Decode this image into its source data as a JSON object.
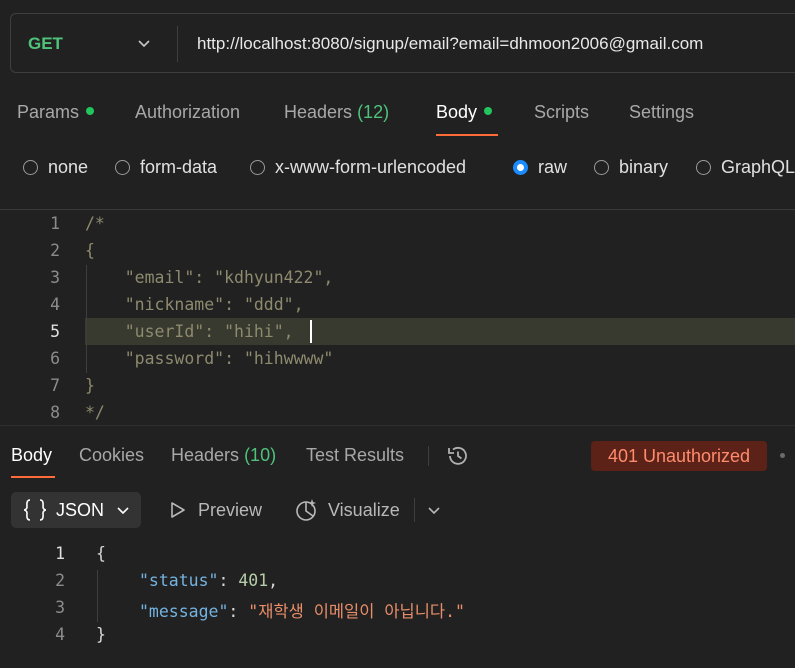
{
  "request": {
    "method": "GET",
    "url": "http://localhost:8080/signup/email?email=dhmoon2006@gmail.com"
  },
  "request_tabs": [
    {
      "label": "Params"
    },
    {
      "label": "Authorization"
    },
    {
      "label": "Headers",
      "count": "(12)"
    },
    {
      "label": "Body"
    },
    {
      "label": "Scripts"
    },
    {
      "label": "Settings"
    }
  ],
  "body_types": [
    "none",
    "form-data",
    "x-www-form-urlencoded",
    "raw",
    "binary",
    "GraphQL"
  ],
  "selected_body_type": "raw",
  "editor": {
    "line_numbers": [
      "1",
      "2",
      "3",
      "4",
      "5",
      "6",
      "7",
      "8"
    ],
    "lines": [
      "/*",
      "{",
      "    \"email\": \"kdhyun422\",",
      "    \"nickname\": \"ddd\",",
      "    \"userId\": \"hihi\",",
      "    \"password\": \"hihwwww\"",
      "}",
      "*/"
    ],
    "current_line": "5"
  },
  "response_tabs": [
    {
      "label": "Body"
    },
    {
      "label": "Cookies"
    },
    {
      "label": "Headers",
      "count": "(10)"
    },
    {
      "label": "Test Results"
    }
  ],
  "status": "401 Unauthorized",
  "response_toolbar": {
    "format_label": "JSON",
    "preview_label": "Preview",
    "visualize_label": "Visualize"
  },
  "response": {
    "line_numbers": [
      "1",
      "2",
      "3",
      "4"
    ],
    "open_brace": "{",
    "status_key": "\"status\"",
    "colon": ": ",
    "status_value": "401",
    "comma": ",",
    "message_key": "\"message\"",
    "message_value": "\"재학생 이메일이 아닙니다.\"",
    "close_brace": "}"
  },
  "colors": {
    "accent": "#ff6c37",
    "method": "#4fc27a",
    "status_bg": "#5c2217",
    "status_text": "#ff8b6e",
    "radio_selected": "#1a8cff"
  },
  "icons": [
    "chevron-down-icon",
    "history-icon",
    "braces-icon",
    "play-icon",
    "visualize-icon"
  ]
}
